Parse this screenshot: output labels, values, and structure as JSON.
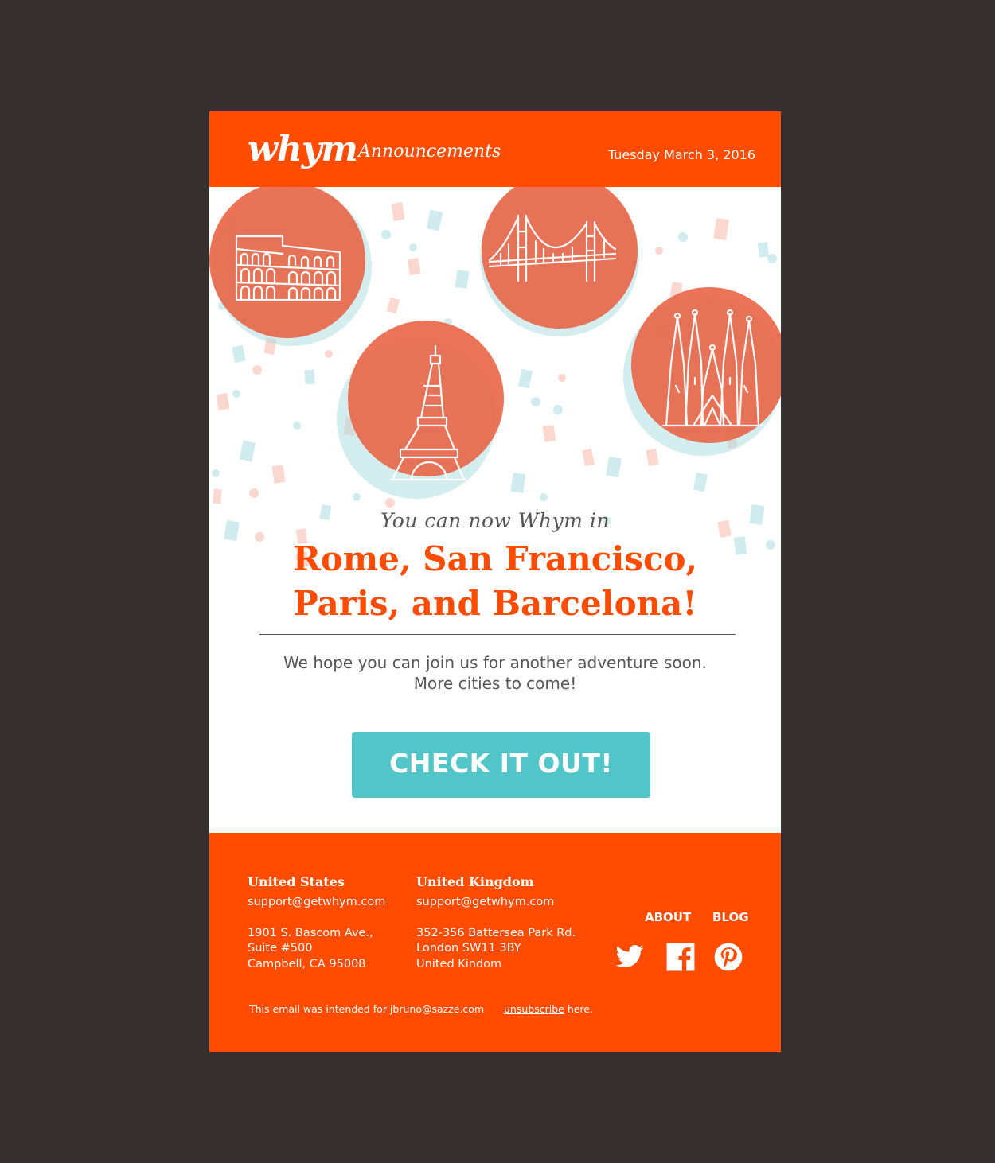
{
  "header": {
    "logo": "whym",
    "subtitle": "Announcements",
    "date": "Tuesday March 3, 2016"
  },
  "hero": {
    "icons": [
      "colosseum-icon",
      "golden-gate-bridge-icon",
      "eiffel-tower-icon",
      "sagrada-familia-icon"
    ]
  },
  "content": {
    "intro": "You can now Whym in",
    "headline_line1": "Rome, San Francisco,",
    "headline_line2": "Paris, and Barcelona!",
    "body_line1": "We hope you can join us for another adventure soon.",
    "body_line2": "More cities to come!",
    "cta_label": "CHECK IT OUT!"
  },
  "footer": {
    "us": {
      "title": "United States",
      "email": "support@getwhym.com",
      "address": [
        "1901 S. Bascom Ave.,",
        "Suite #500",
        "Campbell, CA 95008"
      ]
    },
    "uk": {
      "title": "United Kingdom",
      "email": "support@getwhym.com",
      "address": [
        "352-356 Battersea Park Rd.",
        "London SW11 3BY",
        "United Kindom"
      ]
    },
    "nav": {
      "about": "ABOUT",
      "blog": "BLOG"
    },
    "social": [
      "twitter-icon",
      "facebook-icon",
      "pinterest-icon"
    ],
    "fine_print": "This email was intended for jbruno@sazze.com",
    "unsubscribe_link": "unsubscribe",
    "unsubscribe_suffix": " here."
  },
  "colors": {
    "brand_orange": "#ff4c00",
    "cta_teal": "#52c5c8",
    "circle_fill": "#e8674a",
    "backdrop": "#35302e"
  }
}
